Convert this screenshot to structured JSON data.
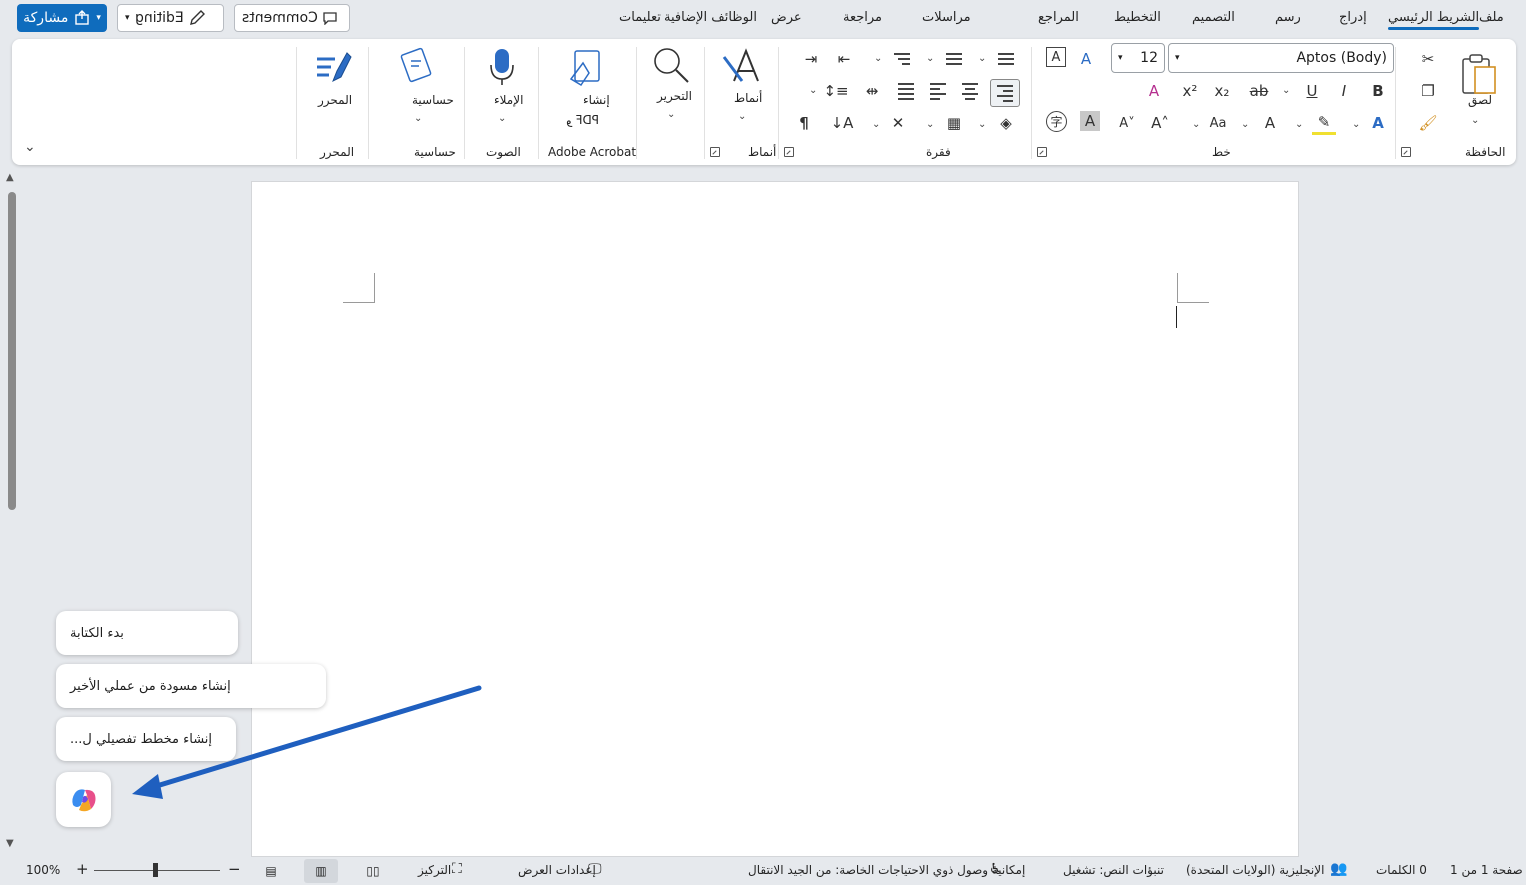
{
  "tabs": [
    {
      "label": "ملف"
    },
    {
      "label": "الشريط الرئيسي"
    },
    {
      "label": "إدراج"
    },
    {
      "label": "رسم"
    },
    {
      "label": "التصميم"
    },
    {
      "label": "التخطيط"
    },
    {
      "label": "المراجع"
    },
    {
      "label": "مراسلات"
    },
    {
      "label": "مراجعة"
    },
    {
      "label": "عرض"
    },
    {
      "label": "الوظائف الإضافية"
    },
    {
      "label": "تعليمات"
    }
  ],
  "top_actions": {
    "comments_label": "Comments",
    "editing_label": "Editing",
    "share_label": "مشاركة"
  },
  "ribbon": {
    "groups": {
      "clipboard": "الحافظة",
      "font": "خط",
      "paragraph": "فقرة",
      "styles": "أنماط",
      "adobe": "Adobe Acrobat",
      "voice": "الصوت",
      "sensitivity": "حساسية",
      "editor": "المحرر"
    },
    "buttons": {
      "paste": "لصق",
      "styles": "أنماط",
      "editing": "التحرير",
      "create_pdf": "إنشاء",
      "create_pdf_line2": "PDF و",
      "dictate": "الإملاء",
      "sensitivity": "حساسية",
      "editor": "المحرر"
    },
    "font": {
      "name": "Aptos (Body)",
      "size": "12"
    }
  },
  "copilot_suggestions": [
    {
      "label": "بدء الكتابة"
    },
    {
      "label": "إنشاء مسودة من عملي الأخير"
    },
    {
      "label": "إنشاء مخطط تفصيلي ل..."
    }
  ],
  "status_bar": {
    "page": "صفحة 1 من 1",
    "words": "0 الكلمات",
    "language": "الإنجليزية (الولايات المتحدة)",
    "predictions": "تنبؤات النص: تشغيل",
    "accessibility": "إمكانية وصول ذوي الاحتياجات الخاصة: من الجيد الانتقال",
    "display_settings": "إعدادات العرض",
    "focus": "التركيز",
    "zoom": "100%"
  },
  "colors": {
    "accent": "#0f6cbd",
    "annotation_arrow": "#1f5fbf",
    "background": "#e6e9ed"
  }
}
